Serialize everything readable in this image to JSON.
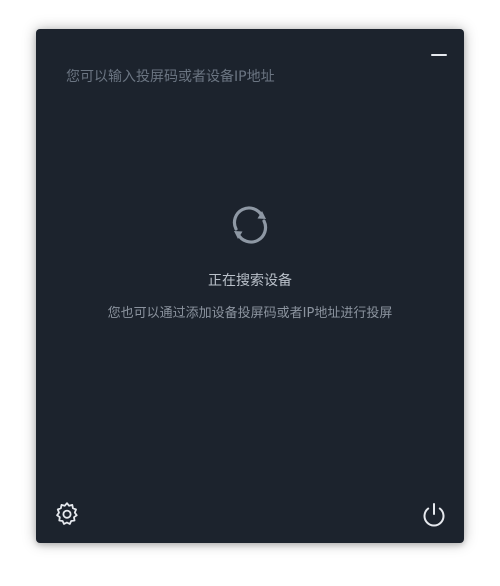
{
  "colors": {
    "window_bg": "#1c232d",
    "icon": "#e6e9ee",
    "spinner": "#8e98a4",
    "title_text": "#b9c0c9",
    "hint_text": "#8b939e",
    "placeholder_text": "#6b7582"
  },
  "header": {
    "input_placeholder": "您可以输入投屏码或者设备IP地址",
    "input_value": "",
    "minimize_icon": "minimize-icon"
  },
  "status": {
    "spinner_icon": "refresh-spinner-icon",
    "title": "正在搜索设备",
    "hint": "您也可以通过添加设备投屏码或者IP地址进行投屏"
  },
  "footer": {
    "settings_icon": "gear-icon",
    "power_icon": "power-icon"
  }
}
